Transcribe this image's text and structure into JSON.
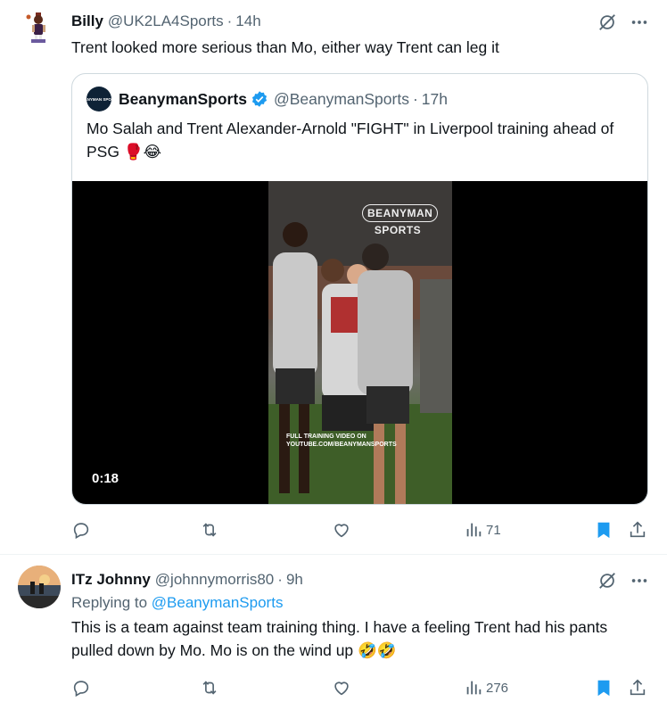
{
  "tweets": [
    {
      "author_name": "Billy",
      "author_handle": "@UK2LA4Sports",
      "dot": "·",
      "time": "14h",
      "text": "Trent looked more serious than Mo, either way Trent can leg it",
      "quote": {
        "avatar_text": "BEANYMAN SPORTS",
        "author_name": "BeanymanSports",
        "author_handle": "@BeanymanSports",
        "dot": "·",
        "time": "17h",
        "text": "Mo Salah and Trent Alexander-Arnold \"FIGHT\" in Liverpool training ahead of PSG 🥊😂",
        "video": {
          "watermark_line1": "BEANYMAN",
          "watermark_line2": "SPORTS",
          "promo_line1": "FULL TRAINING VIDEO ON",
          "promo_line2": "YOUTUBE.COM/BEANYMANSPORTS",
          "duration": "0:18"
        }
      },
      "views": "71"
    },
    {
      "author_name": "ITz Johnny",
      "author_handle": "@johnnymorris80",
      "dot": "·",
      "time": "9h",
      "replying_prefix": "Replying to ",
      "replying_handle": "@BeanymanSports",
      "text": "This is a team against team training thing. I have a feeling Trent had his pants pulled down by Mo. Mo is on the wind up 🤣🤣",
      "views": "276"
    }
  ],
  "icons": {
    "grok": "grok-icon",
    "more": "more-icon",
    "reply": "reply-icon",
    "retweet": "retweet-icon",
    "like": "like-icon",
    "views": "views-icon",
    "bookmark": "bookmark-icon",
    "share": "share-icon",
    "verified": "verified-badge-icon"
  },
  "colors": {
    "accent": "#1d9bf0",
    "text": "#0f1419",
    "secondary": "#536471",
    "border": "#cfd9de"
  }
}
